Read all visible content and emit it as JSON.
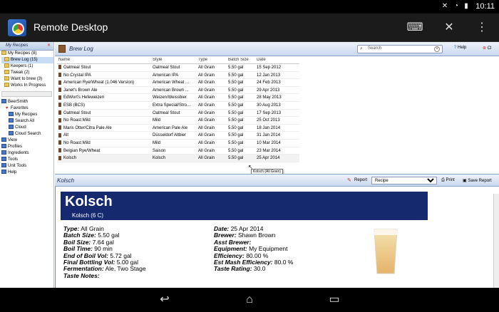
{
  "status": {
    "time": "10:11"
  },
  "app": {
    "title": "Remote Desktop"
  },
  "left": {
    "header": "My Recipes",
    "recipes": [
      {
        "label": "My Recipes (8)",
        "icon": "folder"
      },
      {
        "label": "Brew Log (15)",
        "icon": "folder"
      },
      {
        "label": "Keepers (1)",
        "icon": "folder"
      },
      {
        "label": "Tweak (2)",
        "icon": "folder"
      },
      {
        "label": "Want to brew (3)",
        "icon": "folder"
      },
      {
        "label": "Works In Progress",
        "icon": "folder"
      }
    ],
    "nav": [
      {
        "label": "BeerSmith",
        "icon": "blue"
      },
      {
        "label": "Favorites",
        "icon": "heart"
      },
      {
        "label": "My Recipes",
        "icon": "blue"
      },
      {
        "label": "Search All",
        "icon": "blue"
      },
      {
        "label": "Cloud",
        "icon": "blue"
      },
      {
        "label": "Cloud Search",
        "icon": "blue"
      },
      {
        "label": "View",
        "icon": "blue"
      },
      {
        "label": "Profiles",
        "icon": "blue"
      },
      {
        "label": "Ingredients",
        "icon": "blue"
      },
      {
        "label": "Tools",
        "icon": "blue"
      },
      {
        "label": "Unit Tools",
        "icon": "blue"
      },
      {
        "label": "Help",
        "icon": "blue"
      }
    ]
  },
  "brewlog": {
    "title": "Brew Log",
    "search_placeholder": "Search",
    "help": "Help",
    "close": "Cl",
    "columns": [
      "Name",
      "Style",
      "Type",
      "Batch Size",
      "Date"
    ],
    "rows": [
      [
        "Oatmeal Stout",
        "Oatmeal Stout",
        "All Grain",
        "5.50 gal",
        "15 Sep 2012"
      ],
      [
        "No Crystal IPA",
        "American IPA",
        "All Grain",
        "5.50 gal",
        "12 Jan 2013"
      ],
      [
        "American Rye/Wheat (1.046 Version)",
        "American Wheat ...",
        "All Grain",
        "5.50 gal",
        "24 Feb 2013"
      ],
      [
        "Janet's Brown Ale",
        "American Brown ...",
        "All Grain",
        "5.50 gal",
        "29 Apr 2013"
      ],
      [
        "EdWort's Hefeweizen",
        "Weizen/Weissbier",
        "All Grain",
        "5.50 gal",
        "28 May 2013"
      ],
      [
        "ESB (BCS)",
        "Extra Special/Stro...",
        "All Grain",
        "5.50 gal",
        "30 Aug 2013"
      ],
      [
        "Oatmeal Stout",
        "Oatmeal Stout",
        "All Grain",
        "5.50 gal",
        "17 Sep 2013"
      ],
      [
        "No Roast Mild",
        "Mild",
        "All Grain",
        "5.50 gal",
        "25 Oct 2013"
      ],
      [
        "Maris Otter/Citra Pale Ale",
        "American Pale Ale",
        "All Grain",
        "5.50 gal",
        "18 Jan 2014"
      ],
      [
        "Alt",
        "Düsseldorf Altbier",
        "All Grain",
        "5.50 gal",
        "31 Jan 2014"
      ],
      [
        "No Roast Mild",
        "Mild",
        "All Grain",
        "5.50 gal",
        "10 Mar 2014"
      ],
      [
        "Belgian Rye/Wheat",
        "Saison",
        "All Grain",
        "5.50 gal",
        "23 Mar 2014"
      ],
      [
        "Kolsch",
        "Kolsch",
        "All Grain",
        "5.50 gal",
        "25 Apr 2014"
      ]
    ],
    "tooltip": "Kolsch (All Grain)"
  },
  "kolsch": {
    "title": "Kolsch",
    "report_label": "Report",
    "report_value": "Recipe",
    "print": "Print",
    "save": "Save Report"
  },
  "report": {
    "name": "Kolsch",
    "sub": "Kolsch (6 C)",
    "left": [
      {
        "k": "Type:",
        "v": " All Grain"
      },
      {
        "k": "Batch Size:",
        "v": " 5.50 gal"
      },
      {
        "k": "Boil Size:",
        "v": " 7.64 gal"
      },
      {
        "k": "Boil Time:",
        "v": " 90 min"
      },
      {
        "k": "End of Boil Vol:",
        "v": " 5.72 gal"
      },
      {
        "k": "Final Bottling Vol:",
        "v": " 5.00 gal"
      },
      {
        "k": "Fermentation:",
        "v": " Ale, Two Stage"
      },
      {
        "k": "Taste Notes:",
        "v": ""
      }
    ],
    "right": [
      {
        "k": "Date:",
        "v": " 25 Apr 2014"
      },
      {
        "k": "Brewer:",
        "v": " Shawn Brown"
      },
      {
        "k": "Asst Brewer:",
        "v": ""
      },
      {
        "k": "Equipment:",
        "v": " My Equipment"
      },
      {
        "k": "Efficiency:",
        "v": " 80.00 %"
      },
      {
        "k": "Est Mash Efficiency:",
        "v": " 80.0 %"
      },
      {
        "k": "Taste Rating:",
        "v": " 30.0"
      }
    ]
  }
}
